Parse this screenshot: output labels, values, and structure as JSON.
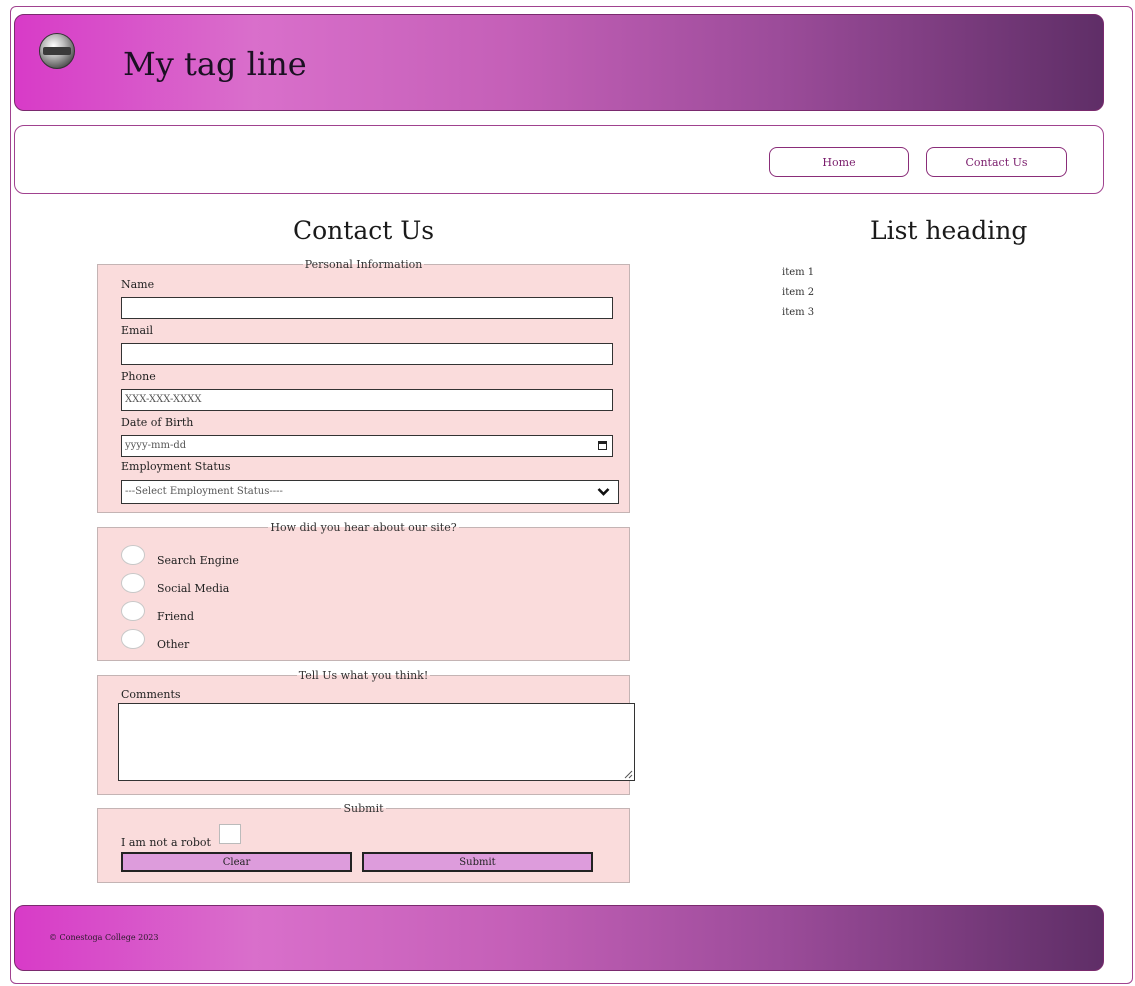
{
  "header": {
    "logo_icon": "toastmasters-logo-icon",
    "tagline": "My tag line"
  },
  "nav": {
    "home_label": "Home",
    "contact_label": "Contact Us"
  },
  "main": {
    "heading": "Contact Us",
    "personal": {
      "legend": "Personal Information",
      "name_label": "Name",
      "email_label": "Email",
      "phone_label": "Phone",
      "phone_placeholder": "XXX-XXX-XXXX",
      "dob_label": "Date of Birth",
      "dob_placeholder": "yyyy-mm-dd",
      "employment_label": "Employment Status",
      "employment_value": "---Select Employment Status----"
    },
    "hear": {
      "legend": "How did you hear about our site?",
      "options": [
        "Search Engine",
        "Social Media",
        "Friend",
        "Other"
      ]
    },
    "think": {
      "legend": "Tell Us what you think!",
      "comments_label": "Comments"
    },
    "submit": {
      "legend": "Submit",
      "robot_label": "I am not a robot",
      "clear_label": "Clear",
      "submit_label": "Submit"
    }
  },
  "aside": {
    "heading": "List heading",
    "items": [
      "item 1",
      "item 2",
      "item 3"
    ]
  },
  "footer": {
    "copyright": "© Conestoga College 2023"
  },
  "colors": {
    "gradient_start": "#d83bc8",
    "gradient_end": "#5f2e67",
    "fieldset_bg": "#fadcdc",
    "button_bg": "#dd9cdc"
  }
}
